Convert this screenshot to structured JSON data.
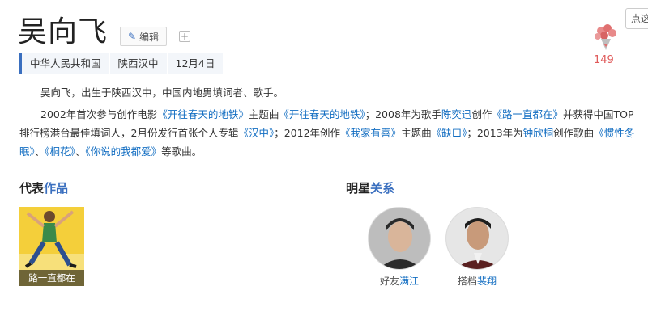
{
  "title": "吴向飞",
  "edit_label": "编辑",
  "plus_label": "+",
  "tags": [
    "中华人民共和国",
    "陕西汉中",
    "12月4日"
  ],
  "like_count": "149",
  "tooltip": "点这",
  "para1": "吴向飞，出生于陕西汉中，中国内地男填词者、歌手。",
  "para2": {
    "t1": "2002年首次参与创作电影",
    "l1": "《开往春天的地铁》",
    "t2": "主题曲",
    "l2": "《开往春天的地铁》",
    "t3": "；2008年为歌手",
    "l3": "陈奕迅",
    "t4": "创作",
    "l4": "《路一直都在》",
    "t5": "并获得中国TOP排行榜港台最佳填词人，2月份发行首张个人专辑",
    "l5": "《汉中》",
    "t6": "；2012年创作",
    "l6": "《我家有喜》",
    "t7": "主题曲",
    "l7": "《缺口》",
    "t8": "；2013年为",
    "l8": "钟欣桐",
    "t9": "创作歌曲",
    "l9": "《惯性冬眠》",
    "t10": "、",
    "l10": "《桐花》",
    "t11": "、",
    "l11": "《你说的我都爱》",
    "t12": "等歌曲。"
  },
  "works": {
    "title_plain": "代表",
    "title_hl": "作品",
    "items": [
      {
        "caption": "路一直都在"
      }
    ]
  },
  "stars": {
    "title_plain": "明星",
    "title_hl": "关系",
    "items": [
      {
        "relation": "好友",
        "name": "满江"
      },
      {
        "relation": "搭档",
        "name": "裴翔"
      }
    ]
  }
}
